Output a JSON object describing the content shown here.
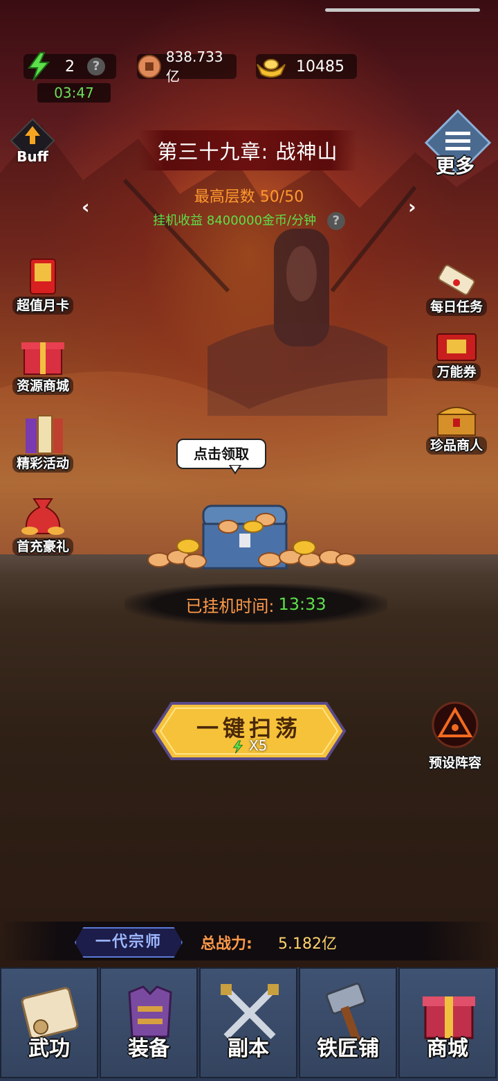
{
  "status": {},
  "resources": {
    "energy": {
      "value": "2",
      "timer": "03:47",
      "help": "?"
    },
    "coins": {
      "value": "838.733亿"
    },
    "gold": {
      "value": "10485"
    }
  },
  "buff_label": "Buff",
  "more_label": "更多",
  "chapter": {
    "title": "第三十九章: 战神山",
    "floors": "最高层数 50/50",
    "idle_income": "挂机收益 8400000金币/分钟",
    "help": "?"
  },
  "left_menu": [
    {
      "label": "超值月卡",
      "icon": "monthly-card-icon"
    },
    {
      "label": "资源商城",
      "icon": "gift-box-icon"
    },
    {
      "label": "精彩活动",
      "icon": "scroll-books-icon"
    },
    {
      "label": "首充豪礼",
      "icon": "money-bag-icon"
    }
  ],
  "right_menu": [
    {
      "label": "每日任务",
      "icon": "scroll-icon"
    },
    {
      "label": "万能券",
      "icon": "ticket-icon"
    },
    {
      "label": "珍品商人",
      "icon": "treasure-chest-icon"
    }
  ],
  "chest": {
    "tooltip": "点击领取"
  },
  "idle_time": {
    "label": "已挂机时间:",
    "value": "13:33"
  },
  "sweep": {
    "label": "一键扫荡",
    "cost": "X5"
  },
  "preset_label": "预设阵容",
  "player": {
    "rank": "一代宗师",
    "power_label": "总战力:",
    "power_value": "5.182亿"
  },
  "navbar": [
    {
      "label": "武功",
      "icon": "martial-scroll-icon"
    },
    {
      "label": "装备",
      "icon": "armor-icon"
    },
    {
      "label": "副本",
      "icon": "crossed-swords-icon"
    },
    {
      "label": "铁匠铺",
      "icon": "hammer-icon"
    },
    {
      "label": "商城",
      "icon": "shop-gift-icon"
    }
  ],
  "colors": {
    "green": "#5de04a",
    "orange": "#ff9a2e",
    "gold": "#ffd36e"
  }
}
